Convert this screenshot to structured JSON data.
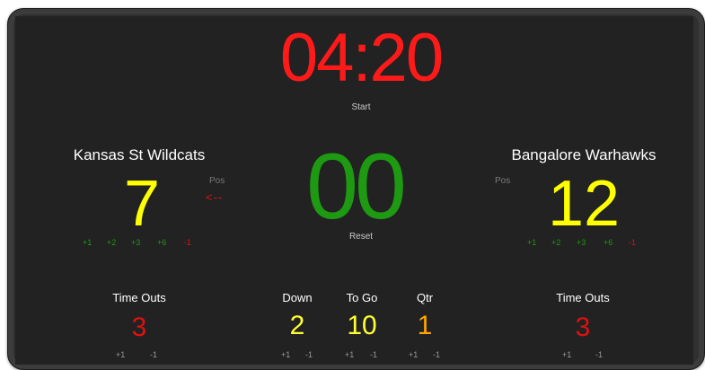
{
  "clock": {
    "time": "04:20",
    "start_label": "Start"
  },
  "ball": {
    "value": "00",
    "reset_label": "Reset"
  },
  "home": {
    "name": "Kansas St Wildcats",
    "score": "7",
    "pos_label": "Pos",
    "pos_indicator": "<--",
    "score_buttons": [
      "+1",
      "+2",
      "+3",
      "+6",
      "-1"
    ],
    "timeouts_label": "Time Outs",
    "timeouts": "3",
    "timeouts_plus": "+1",
    "timeouts_minus": "-1"
  },
  "away": {
    "name": "Bangalore Warhawks",
    "score": "12",
    "pos_label": "Pos",
    "score_buttons": [
      "+1",
      "+2",
      "+3",
      "+6",
      "-1"
    ],
    "timeouts_label": "Time Outs",
    "timeouts": "3",
    "timeouts_plus": "+1",
    "timeouts_minus": "-1"
  },
  "down": {
    "label": "Down",
    "value": "2",
    "plus": "+1",
    "minus": "-1"
  },
  "to_go": {
    "label": "To Go",
    "value": "10",
    "plus": "+1",
    "minus": "-1"
  },
  "qtr": {
    "label": "Qtr",
    "value": "1",
    "plus": "+1",
    "minus": "-1"
  },
  "colors": {
    "clock": "#ff1a1a",
    "score": "#ffff00",
    "ball": "#1e9a12",
    "timeouts": "#e01010",
    "down": "#ffff33",
    "to_go": "#ffff33",
    "qtr": "#ffa500"
  }
}
